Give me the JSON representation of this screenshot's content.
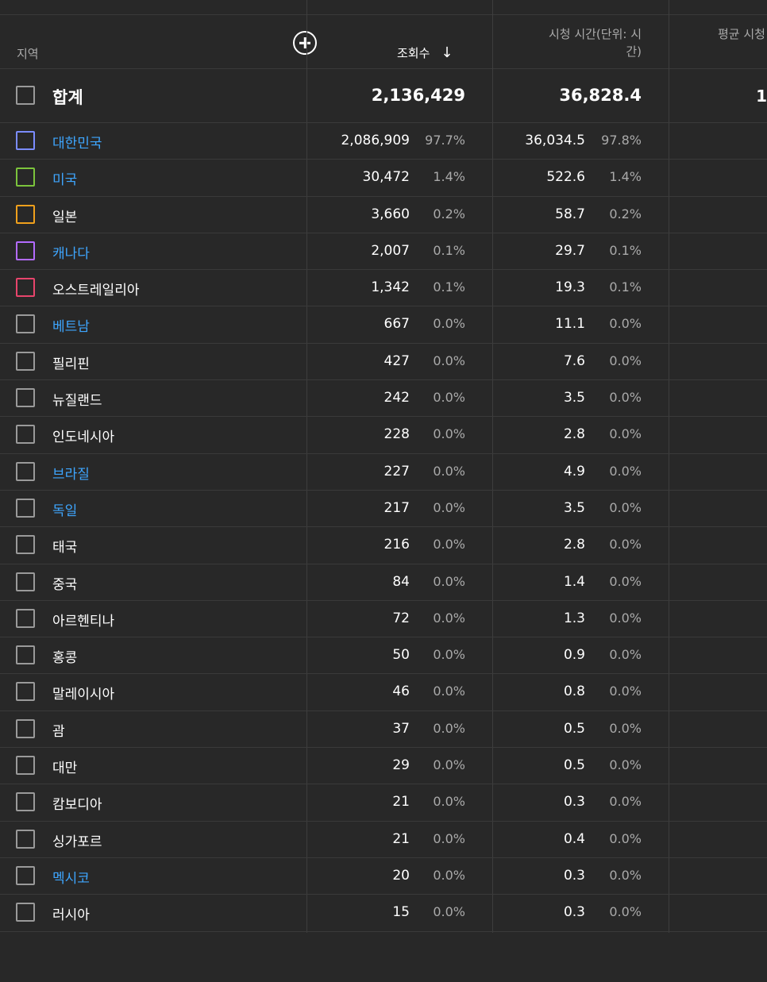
{
  "header": {
    "region_label": "지역",
    "views_label": "조회수",
    "sort_arrow": "↓",
    "watch_time_label_line1": "시청 시간(단위: 시",
    "watch_time_label_line2": "간)",
    "avg_label_partial": "평균 시청"
  },
  "total": {
    "label": "합계",
    "views": "2,136,429",
    "watch_time": "36,828.4",
    "avg_partial": "1"
  },
  "rows": [
    {
      "name": "대한민국",
      "link": true,
      "color": "#7b8cff",
      "views": "2,086,909",
      "views_pct": "97.7%",
      "watch": "36,034.5",
      "watch_pct": "97.8%"
    },
    {
      "name": "미국",
      "link": true,
      "color": "#7cc43c",
      "views": "30,472",
      "views_pct": "1.4%",
      "watch": "522.6",
      "watch_pct": "1.4%"
    },
    {
      "name": "일본",
      "link": false,
      "color": "#f0a01c",
      "views": "3,660",
      "views_pct": "0.2%",
      "watch": "58.7",
      "watch_pct": "0.2%"
    },
    {
      "name": "캐나다",
      "link": true,
      "color": "#b36bff",
      "views": "2,007",
      "views_pct": "0.1%",
      "watch": "29.7",
      "watch_pct": "0.1%"
    },
    {
      "name": "오스트레일리아",
      "link": false,
      "color": "#e8456c",
      "views": "1,342",
      "views_pct": "0.1%",
      "watch": "19.3",
      "watch_pct": "0.1%"
    },
    {
      "name": "베트남",
      "link": true,
      "color": "",
      "views": "667",
      "views_pct": "0.0%",
      "watch": "11.1",
      "watch_pct": "0.0%"
    },
    {
      "name": "필리핀",
      "link": false,
      "color": "",
      "views": "427",
      "views_pct": "0.0%",
      "watch": "7.6",
      "watch_pct": "0.0%"
    },
    {
      "name": "뉴질랜드",
      "link": false,
      "color": "",
      "views": "242",
      "views_pct": "0.0%",
      "watch": "3.5",
      "watch_pct": "0.0%"
    },
    {
      "name": "인도네시아",
      "link": false,
      "color": "",
      "views": "228",
      "views_pct": "0.0%",
      "watch": "2.8",
      "watch_pct": "0.0%"
    },
    {
      "name": "브라질",
      "link": true,
      "color": "",
      "views": "227",
      "views_pct": "0.0%",
      "watch": "4.9",
      "watch_pct": "0.0%"
    },
    {
      "name": "독일",
      "link": true,
      "color": "",
      "views": "217",
      "views_pct": "0.0%",
      "watch": "3.5",
      "watch_pct": "0.0%"
    },
    {
      "name": "태국",
      "link": false,
      "color": "",
      "views": "216",
      "views_pct": "0.0%",
      "watch": "2.8",
      "watch_pct": "0.0%"
    },
    {
      "name": "중국",
      "link": false,
      "color": "",
      "views": "84",
      "views_pct": "0.0%",
      "watch": "1.4",
      "watch_pct": "0.0%"
    },
    {
      "name": "아르헨티나",
      "link": false,
      "color": "",
      "views": "72",
      "views_pct": "0.0%",
      "watch": "1.3",
      "watch_pct": "0.0%"
    },
    {
      "name": "홍콩",
      "link": false,
      "color": "",
      "views": "50",
      "views_pct": "0.0%",
      "watch": "0.9",
      "watch_pct": "0.0%"
    },
    {
      "name": "말레이시아",
      "link": false,
      "color": "",
      "views": "46",
      "views_pct": "0.0%",
      "watch": "0.8",
      "watch_pct": "0.0%"
    },
    {
      "name": "괌",
      "link": false,
      "color": "",
      "views": "37",
      "views_pct": "0.0%",
      "watch": "0.5",
      "watch_pct": "0.0%"
    },
    {
      "name": "대만",
      "link": false,
      "color": "",
      "views": "29",
      "views_pct": "0.0%",
      "watch": "0.5",
      "watch_pct": "0.0%"
    },
    {
      "name": "캄보디아",
      "link": false,
      "color": "",
      "views": "21",
      "views_pct": "0.0%",
      "watch": "0.3",
      "watch_pct": "0.0%"
    },
    {
      "name": "싱가포르",
      "link": false,
      "color": "",
      "views": "21",
      "views_pct": "0.0%",
      "watch": "0.4",
      "watch_pct": "0.0%"
    },
    {
      "name": "멕시코",
      "link": true,
      "color": "",
      "views": "20",
      "views_pct": "0.0%",
      "watch": "0.3",
      "watch_pct": "0.0%"
    },
    {
      "name": "러시아",
      "link": false,
      "color": "",
      "views": "15",
      "views_pct": "0.0%",
      "watch": "0.3",
      "watch_pct": "0.0%"
    }
  ],
  "colors": {
    "background": "#282828",
    "link": "#3ea6ff",
    "checkbox_default": "#9a9a9a"
  }
}
